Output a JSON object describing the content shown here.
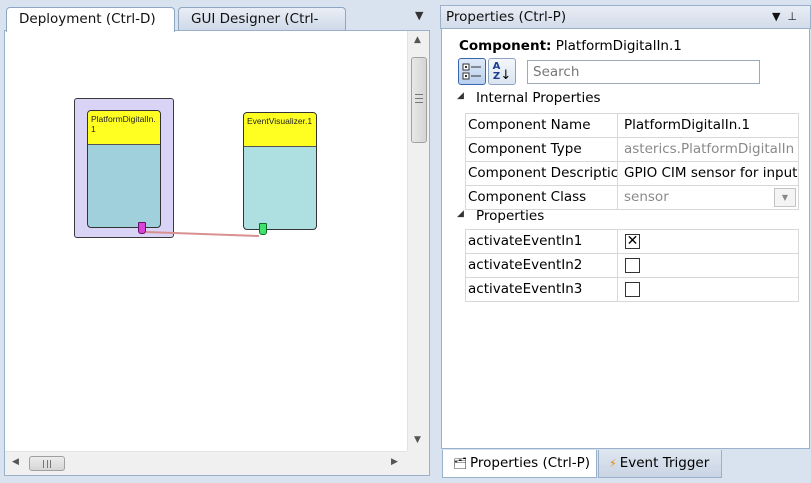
{
  "left_tabs": [
    {
      "label": "Deployment (Ctrl-D)",
      "active": true
    },
    {
      "label": "GUI Designer (Ctrl-G)",
      "active": false
    }
  ],
  "canvas": {
    "components": [
      {
        "title": "PlatformDigitalIn.1",
        "port": "output"
      },
      {
        "title": "EventVisualizer.1",
        "port": "input"
      }
    ]
  },
  "properties_panel": {
    "title": "Properties (Ctrl-P)",
    "component_label": "Component",
    "component_name": "PlatformDigitalIn.1",
    "search_placeholder": "Search",
    "sections": [
      {
        "title": "Internal Properties",
        "rows": [
          {
            "key": "Component Name",
            "value": "PlatformDigitalIn.1"
          },
          {
            "key": "Component Type",
            "value": "asterics.PlatformDigitalIn"
          },
          {
            "key": "Component Descriptic",
            "value": "GPIO CIM sensor for input"
          },
          {
            "key": "Component Class",
            "value": "sensor"
          }
        ]
      },
      {
        "title": "Properties",
        "rows": [
          {
            "key": "activateEventIn1",
            "checked": true
          },
          {
            "key": "activateEventIn2",
            "checked": false
          },
          {
            "key": "activateEventIn3",
            "checked": false
          }
        ]
      }
    ]
  },
  "bottom_tabs": [
    {
      "label": "Properties (Ctrl-P)",
      "icon": "properties-icon",
      "active": true
    },
    {
      "label": "Event Trigger",
      "icon": "lightning-icon",
      "active": false
    }
  ],
  "colors": {
    "component_title_bg": "#ffff22",
    "component_body_bg": "#aee0e2",
    "selected_group_bg": "#d9d3f5",
    "output_port": "#d844d8",
    "input_port": "#3fe36a",
    "channel_line": "#d99090"
  }
}
